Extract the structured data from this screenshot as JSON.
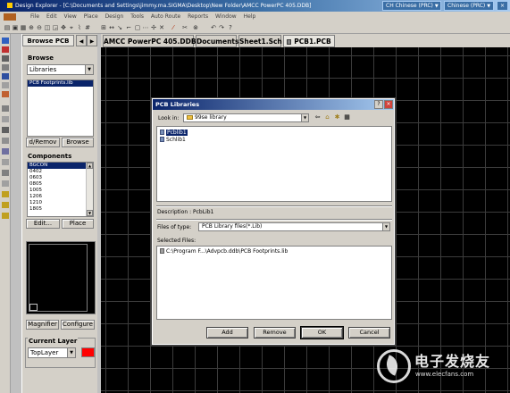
{
  "window": {
    "title": "Design Explorer - [C:\\Documents and Settings\\jimmy.ma.SIGMA\\Desktop\\New Folder\\AMCC PowerPC 405.DDB]",
    "language_bar": [
      "CH Chinese (PRC)",
      "Chinese (PRC)"
    ]
  },
  "menu": [
    "File",
    "Edit",
    "View",
    "Place",
    "Design",
    "Tools",
    "Auto Route",
    "Reports",
    "Window",
    "Help"
  ],
  "toolbar_icons": [
    "open-icon",
    "save-icon",
    "print-icon",
    "zoom-in-icon",
    "zoom-out-icon",
    "zoom-fit-icon",
    "zoom-area-icon",
    "pan-icon",
    "cross-probe-icon",
    "wire-icon",
    "line-icon",
    "select-icon",
    "deselect-icon",
    "move-icon",
    "wand-icon",
    "cut-icon",
    "undo-icon",
    "redo-icon",
    "help-icon"
  ],
  "panel": {
    "tab_label": "Browse PCB",
    "browse_label": "Browse",
    "browse_combo": "Libraries",
    "libraries": [
      "PCB Footprints.lib"
    ],
    "add_remove_button": "d/Remov",
    "browse_button": "Browse",
    "components_label": "Components",
    "components": [
      "BGCON",
      "0402",
      "0603",
      "0805",
      "1005",
      "1206",
      "1210",
      "1805"
    ],
    "edit_button": "Edit...",
    "place_button": "Place",
    "magnifier_button": "Magnifier",
    "configure_button": "Configure",
    "current_layer_label": "Current Layer",
    "current_layer_value": "TopLayer",
    "layer_color": "#ff0000"
  },
  "doc_tabs": [
    "AMCC PowerPC 405.DDB",
    "Documents",
    "Sheet1.Sch",
    "PCB1.PCB"
  ],
  "dialog": {
    "title": "PCB Libraries",
    "look_in_label": "Look in:",
    "look_in_value": "99se library",
    "files": [
      "Pcblib1",
      "Schlib1"
    ],
    "description": "Description : PcbLib1",
    "files_of_type_label": "Files of type:",
    "files_of_type_value": "PCB Library files(*.Lib)",
    "selected_files_label": "Selected Files:",
    "selected_files": [
      "C:\\Program F...\\Advpcb.ddb\\PCB Footprints.lib"
    ],
    "buttons": [
      "Add",
      "Remove",
      "OK",
      "Cancel"
    ]
  },
  "watermark": {
    "cn": "电子发烧友",
    "en": "www.elecfans.com"
  },
  "colors": {
    "canvas_bg": "#000000",
    "grid": "#3c3c3c",
    "title_bar": "#0a246a",
    "selection": "#0a246a"
  }
}
